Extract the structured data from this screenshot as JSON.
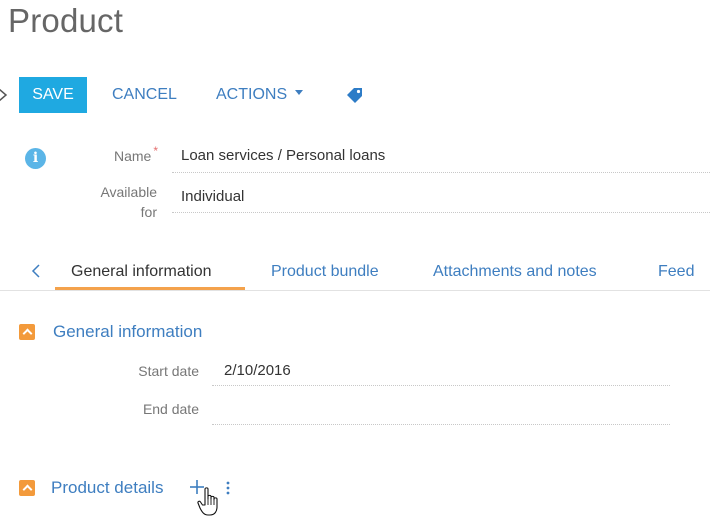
{
  "page": {
    "title": "Product"
  },
  "toolbar": {
    "save_label": "SAVE",
    "cancel_label": "CANCEL",
    "actions_label": "ACTIONS",
    "tag_icon": "tag-icon"
  },
  "fields": {
    "name": {
      "label": "Name",
      "required_mark": "*",
      "value": "Loan services / Personal loans"
    },
    "available_for": {
      "label_line1": "Available",
      "label_line2": "for",
      "value": "Individual"
    }
  },
  "tabs": [
    {
      "label": "General information",
      "active": true
    },
    {
      "label": "Product bundle"
    },
    {
      "label": "Attachments and notes"
    },
    {
      "label": "Feed"
    }
  ],
  "sections": {
    "general": {
      "title": "General information",
      "start_date": {
        "label": "Start date",
        "value": "2/10/2016"
      },
      "end_date": {
        "label": "End date",
        "value": ""
      }
    },
    "details": {
      "title": "Product details"
    }
  },
  "colors": {
    "accent": "#1fa9e1",
    "link": "#3e7ec0",
    "section_toggle": "#f39a3b",
    "active_tab_underline": "#f4a24c",
    "info_icon": "#5bb5e7",
    "required": "#e46f6f"
  }
}
